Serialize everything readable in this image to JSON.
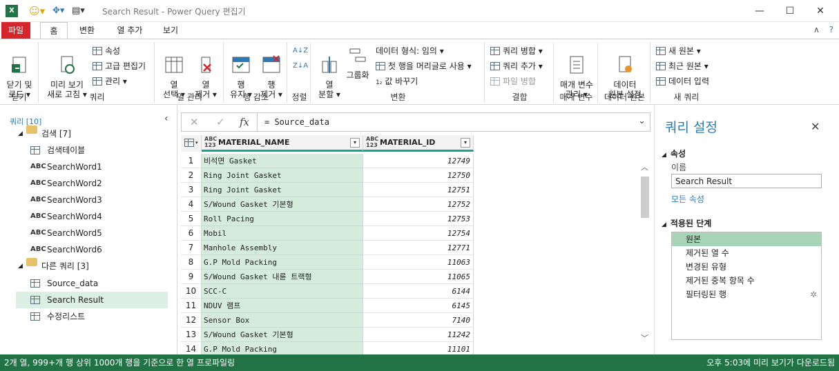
{
  "window": {
    "title": "Search Result - Power Query 편집기",
    "minimize": "—",
    "maximize": "☐",
    "close": "✕"
  },
  "tabs": [
    {
      "label": "파일"
    },
    {
      "label": "홈"
    },
    {
      "label": "변환"
    },
    {
      "label": "열 추가"
    },
    {
      "label": "보기"
    }
  ],
  "ribbon": {
    "close": {
      "btn": "닫기 및\n로드 ▾",
      "group": "닫기"
    },
    "query": {
      "refresh": "미리 보기\n새로 고침 ▾",
      "properties": "속성",
      "advanced": "고급 편집기",
      "manage": "관리 ▾",
      "group": "쿼리"
    },
    "columns": {
      "choose": "열\n선택 ▾",
      "remove": "열\n제거 ▾",
      "group": "열 관리"
    },
    "rows": {
      "keep": "행\n유지 ▾",
      "remove": "행\n제거 ▾",
      "group": "행 감소"
    },
    "sort": {
      "group": "정렬"
    },
    "transform": {
      "split": "열\n분할 ▾",
      "groupby": "그룹화",
      "datatype": "데이터 형식: 임의 ▾",
      "first_row": "첫 행을 머리글로 사용 ▾",
      "replace": "값 바꾸기",
      "group": "변환"
    },
    "combine": {
      "merge": "쿼리 병합 ▾",
      "append": "쿼리 추가 ▾",
      "files": "파일 병합",
      "group": "결합"
    },
    "params": {
      "manage": "매개 변수\n관리 ▾",
      "group": "매개 변수"
    },
    "datasource": {
      "settings": "데이터\n원본 설정",
      "group": "데이터 원본"
    },
    "newquery": {
      "new": "새 원본 ▾",
      "recent": "최근 원본 ▾",
      "enter": "데이터 입력",
      "group": "새 쿼리"
    }
  },
  "left": {
    "header": "쿼리 [10]",
    "items": [
      {
        "label": "검색 [7]"
      },
      {
        "label": "검색테이블"
      },
      {
        "label": "SearchWord1"
      },
      {
        "label": "SearchWord2"
      },
      {
        "label": "SearchWord3"
      },
      {
        "label": "SearchWord4"
      },
      {
        "label": "SearchWord5"
      },
      {
        "label": "SearchWord6"
      },
      {
        "label": "다른 쿼리 [3]"
      },
      {
        "label": "Source_data"
      },
      {
        "label": "Search Result"
      },
      {
        "label": "수정리스트"
      }
    ]
  },
  "formula": {
    "text": "= Source_data"
  },
  "grid": {
    "type_label": "ABC\n123",
    "columns": [
      "MATERIAL_NAME",
      "MATERIAL_ID"
    ],
    "rows": [
      {
        "n": "1",
        "name": "비석면 Gasket",
        "id": "12749"
      },
      {
        "n": "2",
        "name": "Ring Joint Gasket",
        "id": "12750"
      },
      {
        "n": "3",
        "name": "Ring Joint Gasket",
        "id": "12751"
      },
      {
        "n": "4",
        "name": "S/Wound Gasket 기본형",
        "id": "12752"
      },
      {
        "n": "5",
        "name": "Roll Pacing",
        "id": "12753"
      },
      {
        "n": "6",
        "name": "Mobil",
        "id": "12754"
      },
      {
        "n": "7",
        "name": "Manhole Assembly",
        "id": "12771"
      },
      {
        "n": "8",
        "name": "G.P Mold Packing",
        "id": "11063"
      },
      {
        "n": "9",
        "name": "S/Wound Gasket 내륜 트랙형",
        "id": "11065"
      },
      {
        "n": "10",
        "name": "SCC-C",
        "id": "6144"
      },
      {
        "n": "11",
        "name": "NDUV 램프",
        "id": "6145"
      },
      {
        "n": "12",
        "name": "Sensor Box",
        "id": "7140"
      },
      {
        "n": "13",
        "name": "S/Wound Gasket 기본형",
        "id": "11242"
      },
      {
        "n": "14",
        "name": "G.P Mold Packing",
        "id": "11101"
      }
    ]
  },
  "settings": {
    "title": "쿼리 설정",
    "properties": "속성",
    "name_label": "이름",
    "name_value": "Search Result",
    "all_props": "모든 속성",
    "applied_steps": "적용된 단계",
    "steps": [
      {
        "label": "원본"
      },
      {
        "label": "제거된 열 수"
      },
      {
        "label": "변경된 유형"
      },
      {
        "label": "제거된 중복 항목 수"
      },
      {
        "label": "필터링된 행"
      }
    ]
  },
  "status": {
    "left1": "2개 열, 999+개 행",
    "left2": "상위 1000개 행을 기준으로 한 열 프로파일링",
    "right": "오후 5:03에 미리 보기가 다운로드됨"
  },
  "colors": {
    "accent": "#217346",
    "file_tab": "#d6262b",
    "selection": "#d5ebde",
    "link": "#2a7ab8"
  }
}
